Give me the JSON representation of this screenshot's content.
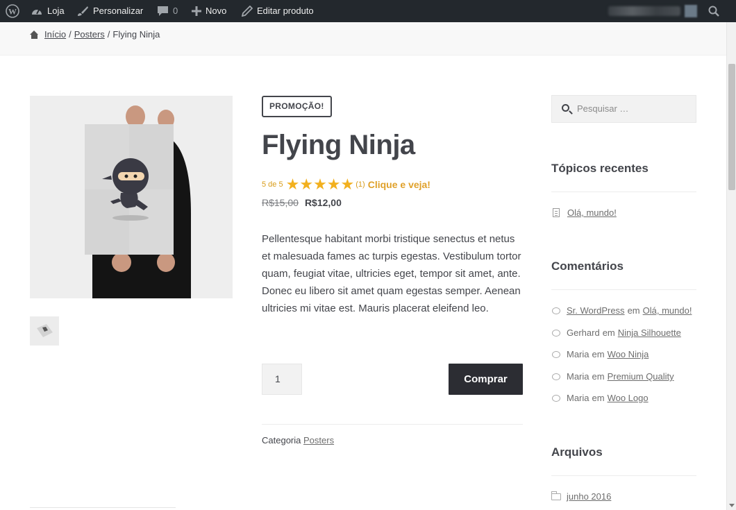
{
  "admin_bar": {
    "shop": "Loja",
    "customize": "Personalizar",
    "comments_count": "0",
    "new": "Novo",
    "edit": "Editar produto"
  },
  "breadcrumb": {
    "home": "Início",
    "sep1": "/",
    "category": "Posters",
    "sep2": "/",
    "current": "Flying Ninja"
  },
  "product": {
    "badge": "PROMOÇÃO!",
    "title": "Flying Ninja",
    "rating_text": "5 de 5",
    "rating_value": 5,
    "review_count": "(1)",
    "rating_cta": "Clique e veja!",
    "price_old": "R$15,00",
    "price_new": "R$12,00",
    "description": "Pellentesque habitant morbi tristique senectus et netus et malesuada fames ac turpis egestas. Vestibulum tortor quam, feugiat vitae, ultricies eget, tempor sit amet, ante. Donec eu libero sit amet quam egestas semper. Aenean ultricies mi vitae est. Mauris placerat eleifend leo.",
    "quantity": "1",
    "buy_label": "Comprar",
    "category_label": "Categoria",
    "category_link": "Posters"
  },
  "sidebar": {
    "search_placeholder": "Pesquisar …",
    "recent_title": "Tópicos recentes",
    "recent_posts": [
      "Olá, mundo!"
    ],
    "comments_title": "Comentários",
    "comments": [
      {
        "author": "Sr. WordPress",
        "author_link": true,
        "on": "em",
        "post": "Olá, mundo!"
      },
      {
        "author": "Gerhard",
        "author_link": false,
        "on": "em",
        "post": "Ninja Silhouette"
      },
      {
        "author": "Maria",
        "author_link": false,
        "on": "em",
        "post": "Woo Ninja"
      },
      {
        "author": "Maria",
        "author_link": false,
        "on": "em",
        "post": "Premium Quality"
      },
      {
        "author": "Maria",
        "author_link": false,
        "on": "em",
        "post": "Woo Logo"
      }
    ],
    "archives_title": "Arquivos",
    "archives": [
      "junho 2016"
    ]
  },
  "colors": {
    "admin_bar": "#23282d",
    "accent_star": "#f2b01e",
    "button": "#2c2d33",
    "text": "#43454b"
  }
}
